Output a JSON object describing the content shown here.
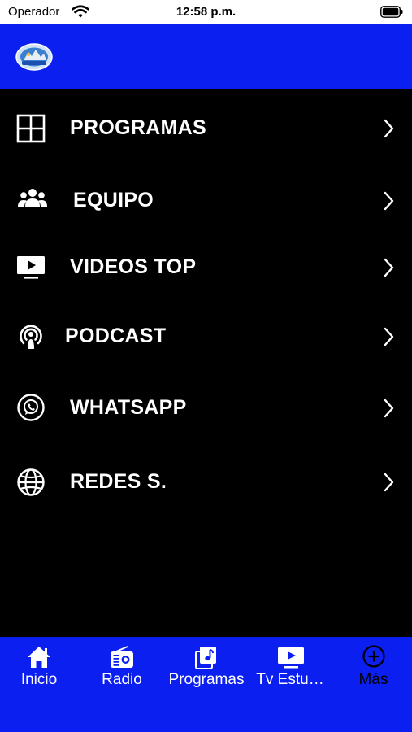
{
  "status_bar": {
    "carrier": "Operador",
    "time": "12:58 p.m."
  },
  "menu": {
    "items": [
      {
        "label": "PROGRAMAS",
        "icon": "grid-icon"
      },
      {
        "label": "EQUIPO",
        "icon": "group-icon"
      },
      {
        "label": "VIDEOS TOP",
        "icon": "tv-play-icon"
      },
      {
        "label": "PODCAST",
        "icon": "podcast-icon"
      },
      {
        "label": "WHATSAPP",
        "icon": "whatsapp-icon"
      },
      {
        "label": "REDES S.",
        "icon": "globe-icon"
      }
    ]
  },
  "tab_bar": {
    "tabs": [
      {
        "label": "Inicio",
        "icon": "home-icon"
      },
      {
        "label": "Radio",
        "icon": "radio-icon"
      },
      {
        "label": "Programas",
        "icon": "music-note-icon"
      },
      {
        "label": "Tv  Estu…",
        "icon": "tv-play-icon"
      },
      {
        "label": "Más",
        "icon": "plus-circle-icon",
        "active": true
      }
    ]
  },
  "colors": {
    "header_blue": "#0a1ff0",
    "menu_bg": "#000000",
    "tab_active": "#000000",
    "tab_inactive": "#ffffff"
  }
}
